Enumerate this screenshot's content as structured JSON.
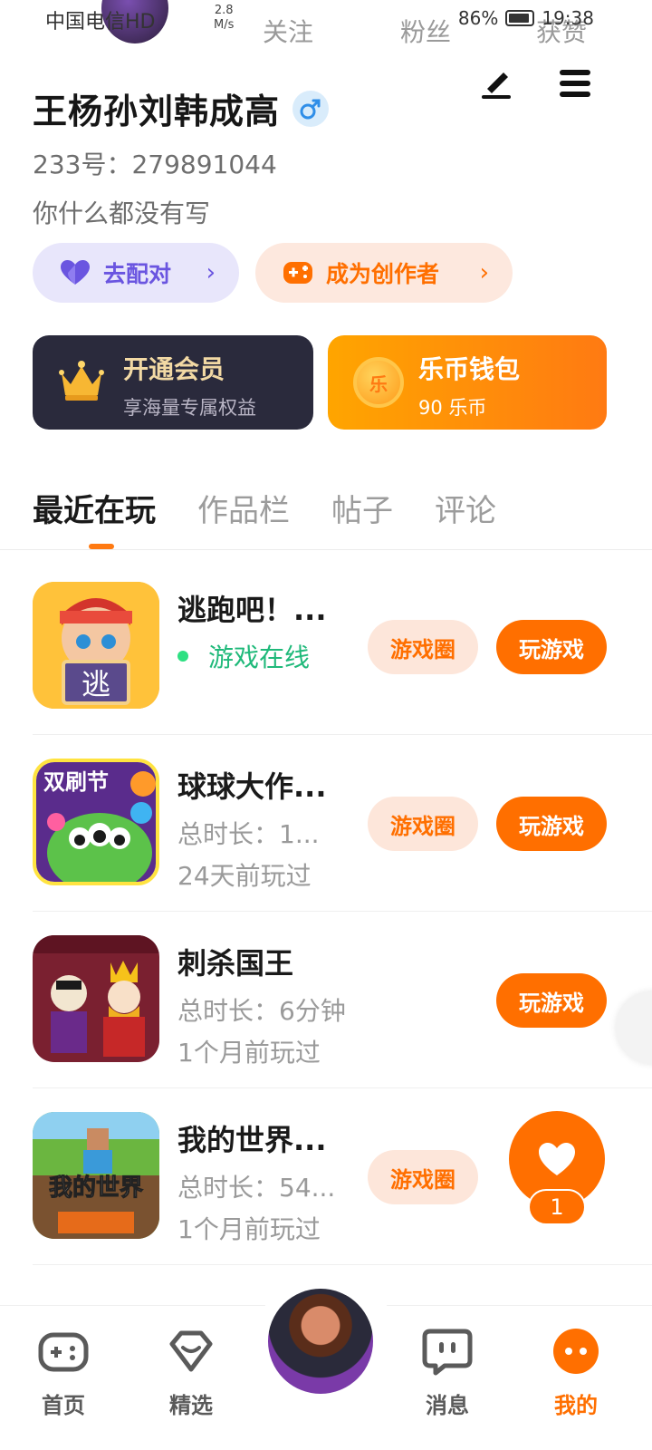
{
  "status_bar": {
    "carrier": "中国电信HD",
    "net_speed_value": "2.8",
    "net_speed_unit": "M/s",
    "battery": "86%",
    "time": "19:38"
  },
  "header_tabs": [
    "关注",
    "粉丝",
    "获赞"
  ],
  "profile": {
    "name": "王杨孙刘韩成高",
    "uid": "233号：279891044",
    "bio": "你什么都没有写"
  },
  "actions": {
    "match_label": "去配对",
    "creator_label": "成为创作者"
  },
  "cards": {
    "vip": {
      "title": "开通会员",
      "subtitle": "享海量专属权益"
    },
    "wallet": {
      "title": "乐币钱包",
      "subtitle": "90 乐币",
      "coin_glyph": "乐"
    }
  },
  "tabs": [
    "最近在玩",
    "作品栏",
    "帖子",
    "评论"
  ],
  "games": [
    {
      "title": "逃跑吧！...",
      "line2": "游戏在线",
      "line3": "",
      "circle": "游戏圈",
      "play": "玩游戏",
      "thumb_text": "逃"
    },
    {
      "title": "球球大作...",
      "line2": "总时长：1...",
      "line3": "24天前玩过",
      "circle": "游戏圈",
      "play": "玩游戏",
      "thumb_text": "双刷节"
    },
    {
      "title": "刺杀国王",
      "line2": "总时长：6分钟",
      "line3": "1个月前玩过",
      "circle": "",
      "play": "玩游戏",
      "thumb_text": ""
    },
    {
      "title": "我的世界...",
      "line2": "总时长：54...",
      "line3": "1个月前玩过",
      "circle": "游戏圈",
      "play": "",
      "thumb_text": "我的世界"
    }
  ],
  "float": {
    "like_count": "1"
  },
  "bottom_nav": [
    "首页",
    "精选",
    "消息",
    "我的"
  ],
  "colors": {
    "accent": "#ff6f00",
    "online": "#1fb97a"
  }
}
